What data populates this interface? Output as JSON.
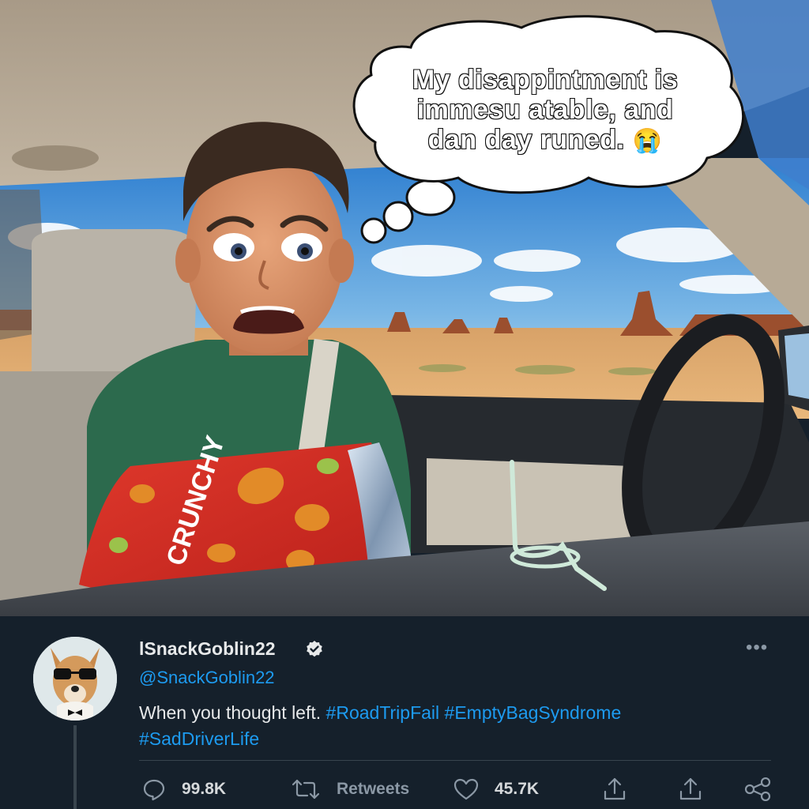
{
  "scene": {
    "thought_bubble": {
      "line1": "My disappintment is",
      "line2": "immesu atable, and",
      "line3": "dan day runed.",
      "emoji": "😭"
    },
    "snack_bag_text": "CRUNCHY"
  },
  "tweet": {
    "display_name": "lSnackGoblin22",
    "verified_icon": "verified-badge-icon",
    "handle": "@SnackGoblin22",
    "text_plain": "When you thought left.",
    "hashtag_1": "#RoadTripFail",
    "hashtag_2": "#EmptyBagSyndrome",
    "hashtag_3": "#SadDriverLife",
    "more_label": "•••"
  },
  "actions": {
    "reply_icon": "reply-icon",
    "replies": "99.8K",
    "retweet_icon": "retweet-icon",
    "retweets_label": "Retweets",
    "like_icon": "heart-icon",
    "likes": "45.7K",
    "share_icon": "share-icon",
    "upload_icon": "upload-icon",
    "link_icon": "link-share-icon"
  },
  "colors": {
    "background": "#15202b",
    "accent": "#1d9bf0",
    "muted": "#8b98a5",
    "text": "#e7e9ea"
  }
}
